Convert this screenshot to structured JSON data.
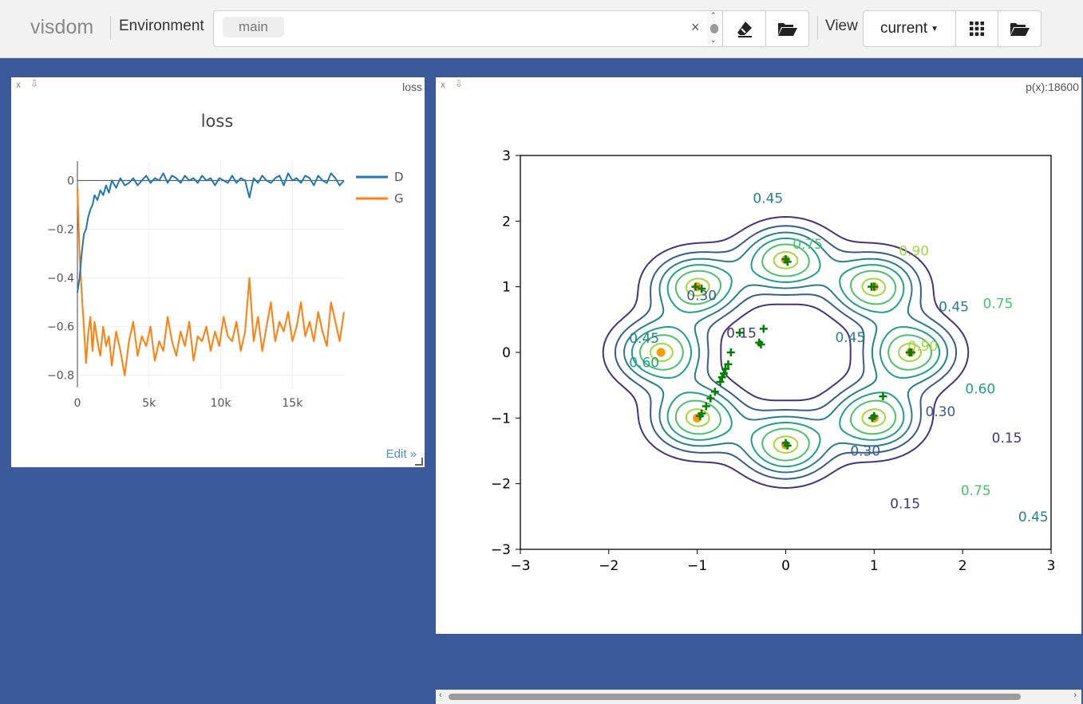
{
  "topbar": {
    "logo": "visdom",
    "env_label": "Environment",
    "env_chip": "main",
    "clear_label": "×",
    "view_label": "View",
    "view_select": "current"
  },
  "panes": {
    "loss": {
      "close": "x",
      "download": "⇩",
      "title_corner": "loss",
      "edit_link": "Edit »"
    },
    "contour": {
      "close": "x",
      "download": "⇩",
      "title_corner": "p(x):18600"
    }
  },
  "chart_data": [
    {
      "type": "line",
      "title": "loss",
      "xlabel": "",
      "ylabel": "",
      "xlim": [
        0,
        18600
      ],
      "ylim": [
        -0.85,
        0.08
      ],
      "xticks": [
        0,
        5000,
        10000,
        15000
      ],
      "xtick_labels": [
        "0",
        "5k",
        "10k",
        "15k"
      ],
      "yticks": [
        0,
        -0.2,
        -0.4,
        -0.6,
        -0.8
      ],
      "ytick_labels": [
        "0",
        "−0.2",
        "−0.4",
        "−0.6",
        "−0.8"
      ],
      "legend_position": "top-right",
      "series": [
        {
          "name": "D",
          "color": "#1f77b4",
          "x": [
            0,
            150,
            300,
            450,
            600,
            750,
            900,
            1050,
            1200,
            1400,
            1600,
            1800,
            2000,
            2200,
            2400,
            2700,
            3000,
            3300,
            3600,
            3900,
            4200,
            4500,
            4800,
            5100,
            5400,
            5700,
            6000,
            6300,
            6600,
            6900,
            7200,
            7500,
            7800,
            8100,
            8400,
            8700,
            9000,
            9300,
            9600,
            9900,
            10200,
            10500,
            10800,
            11100,
            11400,
            11700,
            12000,
            12300,
            12600,
            12900,
            13200,
            13500,
            13800,
            14100,
            14400,
            14700,
            15000,
            15300,
            15600,
            15900,
            16200,
            16500,
            16800,
            17100,
            17400,
            17700,
            18000,
            18300,
            18600
          ],
          "y": [
            -0.46,
            -0.4,
            -0.3,
            -0.22,
            -0.2,
            -0.15,
            -0.12,
            -0.1,
            -0.06,
            -0.08,
            -0.04,
            -0.06,
            -0.02,
            -0.05,
            0.0,
            -0.03,
            0.01,
            -0.02,
            -0.01,
            0.01,
            -0.02,
            0.0,
            0.02,
            -0.01,
            0.01,
            0.0,
            0.03,
            -0.01,
            0.02,
            0.01,
            -0.01,
            0.02,
            0.0,
            0.01,
            -0.01,
            0.02,
            0.0,
            0.01,
            -0.02,
            0.01,
            0.0,
            -0.01,
            0.02,
            -0.01,
            0.01,
            0.0,
            -0.07,
            0.01,
            -0.01,
            0.02,
            0.0,
            -0.01,
            0.01,
            0.02,
            -0.02,
            0.03,
            0.0,
            0.01,
            -0.01,
            0.02,
            0.01,
            -0.02,
            0.02,
            0.0,
            -0.01,
            0.03,
            0.01,
            -0.02,
            0.0
          ]
        },
        {
          "name": "G",
          "color": "#ff7f0e",
          "x": [
            0,
            150,
            300,
            450,
            600,
            750,
            900,
            1050,
            1200,
            1400,
            1600,
            1800,
            2000,
            2200,
            2400,
            2700,
            3000,
            3300,
            3600,
            3900,
            4200,
            4500,
            4800,
            5100,
            5400,
            5700,
            6000,
            6300,
            6600,
            6900,
            7200,
            7500,
            7800,
            8100,
            8400,
            8700,
            9000,
            9300,
            9600,
            9900,
            10200,
            10500,
            10800,
            11100,
            11400,
            11700,
            12000,
            12300,
            12600,
            12900,
            13200,
            13500,
            13800,
            14100,
            14400,
            14700,
            15000,
            15300,
            15600,
            15900,
            16200,
            16500,
            16800,
            17100,
            17400,
            17700,
            18000,
            18300,
            18600
          ],
          "y": [
            -0.03,
            -0.3,
            -0.46,
            -0.6,
            -0.75,
            -0.63,
            -0.56,
            -0.7,
            -0.58,
            -0.66,
            -0.72,
            -0.6,
            -0.68,
            -0.64,
            -0.76,
            -0.62,
            -0.7,
            -0.8,
            -0.66,
            -0.58,
            -0.72,
            -0.64,
            -0.68,
            -0.6,
            -0.74,
            -0.66,
            -0.7,
            -0.56,
            -0.66,
            -0.72,
            -0.62,
            -0.68,
            -0.58,
            -0.74,
            -0.64,
            -0.66,
            -0.6,
            -0.7,
            -0.62,
            -0.68,
            -0.56,
            -0.64,
            -0.66,
            -0.58,
            -0.7,
            -0.62,
            -0.4,
            -0.66,
            -0.56,
            -0.7,
            -0.6,
            -0.5,
            -0.66,
            -0.58,
            -0.62,
            -0.54,
            -0.66,
            -0.6,
            -0.5,
            -0.64,
            -0.58,
            -0.66,
            -0.54,
            -0.62,
            -0.68,
            -0.5,
            -0.58,
            -0.66,
            -0.54
          ]
        }
      ]
    },
    {
      "type": "contour",
      "xlim": [
        -3,
        3
      ],
      "ylim": [
        -3,
        3
      ],
      "xticks": [
        -3,
        -2,
        -1,
        0,
        1,
        2,
        3
      ],
      "xtick_labels": [
        "−3",
        "−2",
        "−1",
        "0",
        "1",
        "2",
        "3"
      ],
      "yticks": [
        3,
        2,
        1,
        0,
        -1,
        -2,
        -3
      ],
      "ytick_labels": [
        "3",
        "2",
        "1",
        "0",
        "−1",
        "−2",
        "−3"
      ],
      "levels": [
        0.15,
        0.3,
        0.45,
        0.6,
        0.75,
        0.9
      ],
      "contour_labels": [
        {
          "text": "0.45",
          "x": -0.2,
          "y": 2.35
        },
        {
          "text": "0.75",
          "x": 0.25,
          "y": 1.65
        },
        {
          "text": "0.90",
          "x": 1.45,
          "y": 1.55
        },
        {
          "text": "0.30",
          "x": -0.95,
          "y": 0.87
        },
        {
          "text": "0.45",
          "x": 1.9,
          "y": 0.7
        },
        {
          "text": "0.75",
          "x": 2.4,
          "y": 0.75
        },
        {
          "text": "0.45",
          "x": -1.6,
          "y": 0.22
        },
        {
          "text": "0.15",
          "x": -0.5,
          "y": 0.3
        },
        {
          "text": "0.45",
          "x": 0.73,
          "y": 0.23
        },
        {
          "text": "0.60",
          "x": -1.6,
          "y": -0.15
        },
        {
          "text": "0.90",
          "x": 1.55,
          "y": 0.1
        },
        {
          "text": "0.60",
          "x": 2.2,
          "y": -0.55
        },
        {
          "text": "0.30",
          "x": 1.75,
          "y": -0.9
        },
        {
          "text": "0.15",
          "x": 2.5,
          "y": -1.3
        },
        {
          "text": "0.30",
          "x": 0.9,
          "y": -1.5
        },
        {
          "text": "0.75",
          "x": 2.15,
          "y": -2.1
        },
        {
          "text": "0.15",
          "x": 1.35,
          "y": -2.3
        },
        {
          "text": "0.45",
          "x": 2.8,
          "y": -2.5
        }
      ],
      "modes": [
        {
          "x": 0,
          "y": 1.41
        },
        {
          "x": 1,
          "y": 1
        },
        {
          "x": 1.41,
          "y": 0
        },
        {
          "x": 1,
          "y": -1
        },
        {
          "x": 0,
          "y": -1.41
        },
        {
          "x": -1,
          "y": -1
        },
        {
          "x": -1.41,
          "y": 0
        },
        {
          "x": -1,
          "y": 1
        }
      ],
      "samples": [
        {
          "x": 0,
          "y": 1.42
        },
        {
          "x": 0.02,
          "y": 1.38
        },
        {
          "x": 1.0,
          "y": 1.0
        },
        {
          "x": 0.97,
          "y": 1.0
        },
        {
          "x": 1.42,
          "y": 0.0
        },
        {
          "x": 1.4,
          "y": 0.0
        },
        {
          "x": 1.0,
          "y": -0.97
        },
        {
          "x": 0.98,
          "y": -1.0
        },
        {
          "x": 1.1,
          "y": -0.67
        },
        {
          "x": 0.0,
          "y": -1.38
        },
        {
          "x": 0.02,
          "y": -1.42
        },
        {
          "x": -1.02,
          "y": 1.0
        },
        {
          "x": -0.95,
          "y": 0.97
        },
        {
          "x": -0.97,
          "y": -0.97
        },
        {
          "x": -0.95,
          "y": -0.93
        },
        {
          "x": -0.9,
          "y": -0.82
        },
        {
          "x": -0.85,
          "y": -0.7
        },
        {
          "x": -0.8,
          "y": -0.6
        },
        {
          "x": -0.74,
          "y": -0.45
        },
        {
          "x": -0.72,
          "y": -0.38
        },
        {
          "x": -0.7,
          "y": -0.32
        },
        {
          "x": -0.68,
          "y": -0.25
        },
        {
          "x": -0.65,
          "y": -0.18
        },
        {
          "x": -0.62,
          "y": 0.0
        },
        {
          "x": -0.3,
          "y": 0.15
        },
        {
          "x": -0.28,
          "y": 0.12
        },
        {
          "x": -0.25,
          "y": 0.36
        },
        {
          "x": -0.52,
          "y": 0.3
        }
      ]
    }
  ],
  "colors": {
    "background": "#3c5a99",
    "topbar": "#f2f2f2",
    "mode_marker": "#ff9900",
    "sample_marker": "#008000"
  }
}
